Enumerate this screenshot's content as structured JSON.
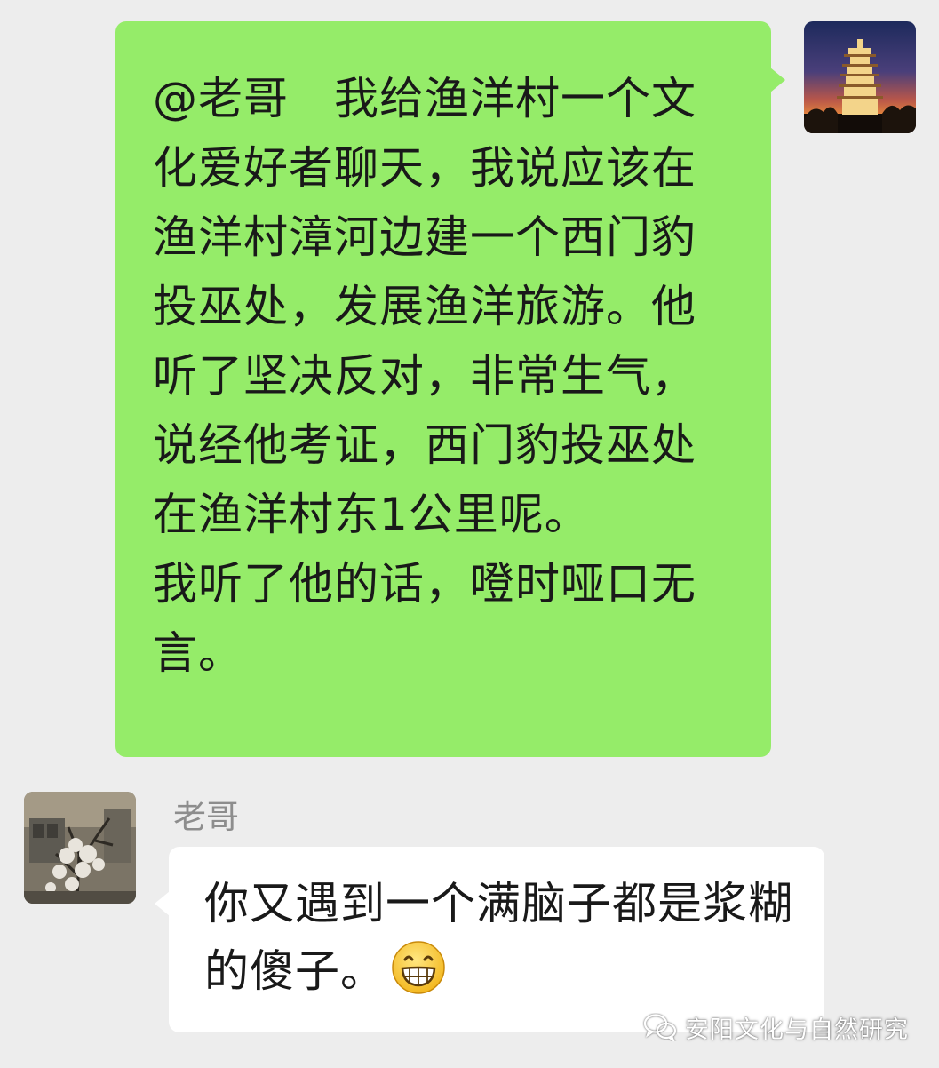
{
  "messages": {
    "outgoing": {
      "text": "@老哥　我给渔洋村一个文化爱好者聊天，我说应该在渔洋村漳河边建一个西门豹投巫处，发展渔洋旅游。他听了坚决反对，非常生气，说经他考证，西门豹投巫处在渔洋村东1公里呢。\n我听了他的话，噔时哑口无言。",
      "avatar_icon": "pagoda-sunset-avatar",
      "bubble_color": "#95ec69"
    },
    "incoming": {
      "sender_name": "老哥",
      "text": "你又遇到一个满脑子都是浆糊的傻子。",
      "emoji_icon": "grin-emoji",
      "avatar_icon": "snowy-tree-avatar",
      "bubble_color": "#ffffff"
    }
  },
  "watermark": {
    "text": "安阳文化与自然研究",
    "icon": "wechat-icon"
  },
  "colors": {
    "background": "#ededed",
    "sender_name": "#8d8d8d",
    "text": "#191919"
  }
}
